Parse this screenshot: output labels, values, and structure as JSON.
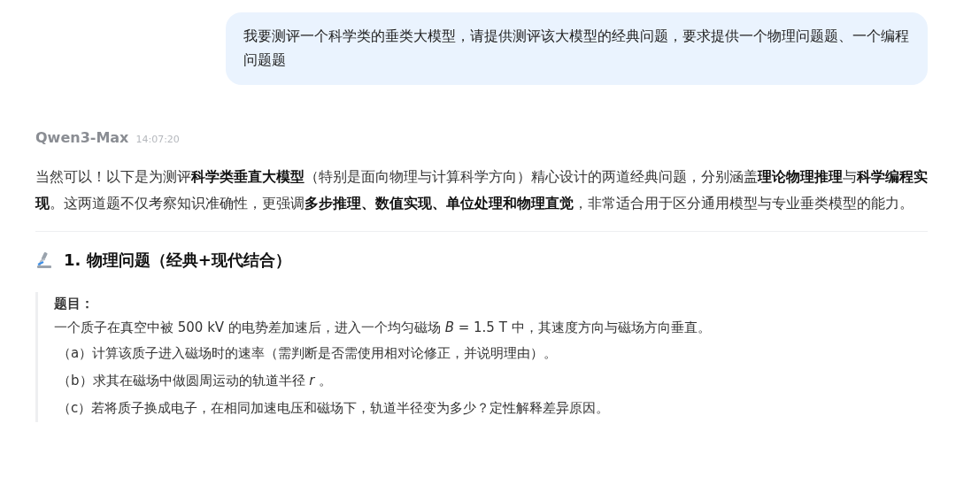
{
  "user_message": {
    "text": "我要测评一个科学类的垂类大模型，请提供测评该大模型的经典问题，要求提供一个物理问题题、一个编程问题题"
  },
  "reply": {
    "model": "Qwen3-Max",
    "time": "14:07:20",
    "intro": "当然可以！以下是为测评**科学类垂直大模型**（特别是面向物理与计算科学方向）精心设计的两道经典问题，分别涵盖**理论物理推理**与**科学编程实现**。这两道题不仅考察知识准确性，更强调**多步推理、数值实现、单位处理和物理直觉**，非常适合用于区分通用模型与专业垂类模型的能力。",
    "section_title": "1. 物理问题（经典+现代结合）",
    "question": {
      "label": "题目：",
      "text": "一个质子在真空中被 500 kV 的电势差加速后，进入一个均匀磁场 *B* = 1.5 T 中，其速度方向与磁场方向垂直。",
      "parts": [
        "（a）计算该质子进入磁场时的速率（需判断是否需使用相对论修正，并说明理由）。",
        "（b）求其在磁场中做圆周运动的轨道半径 *r* 。",
        "（c）若将质子换成电子，在相同加速电压和磁场下，轨道半径变为多少？定性解释差异原因。"
      ]
    }
  }
}
